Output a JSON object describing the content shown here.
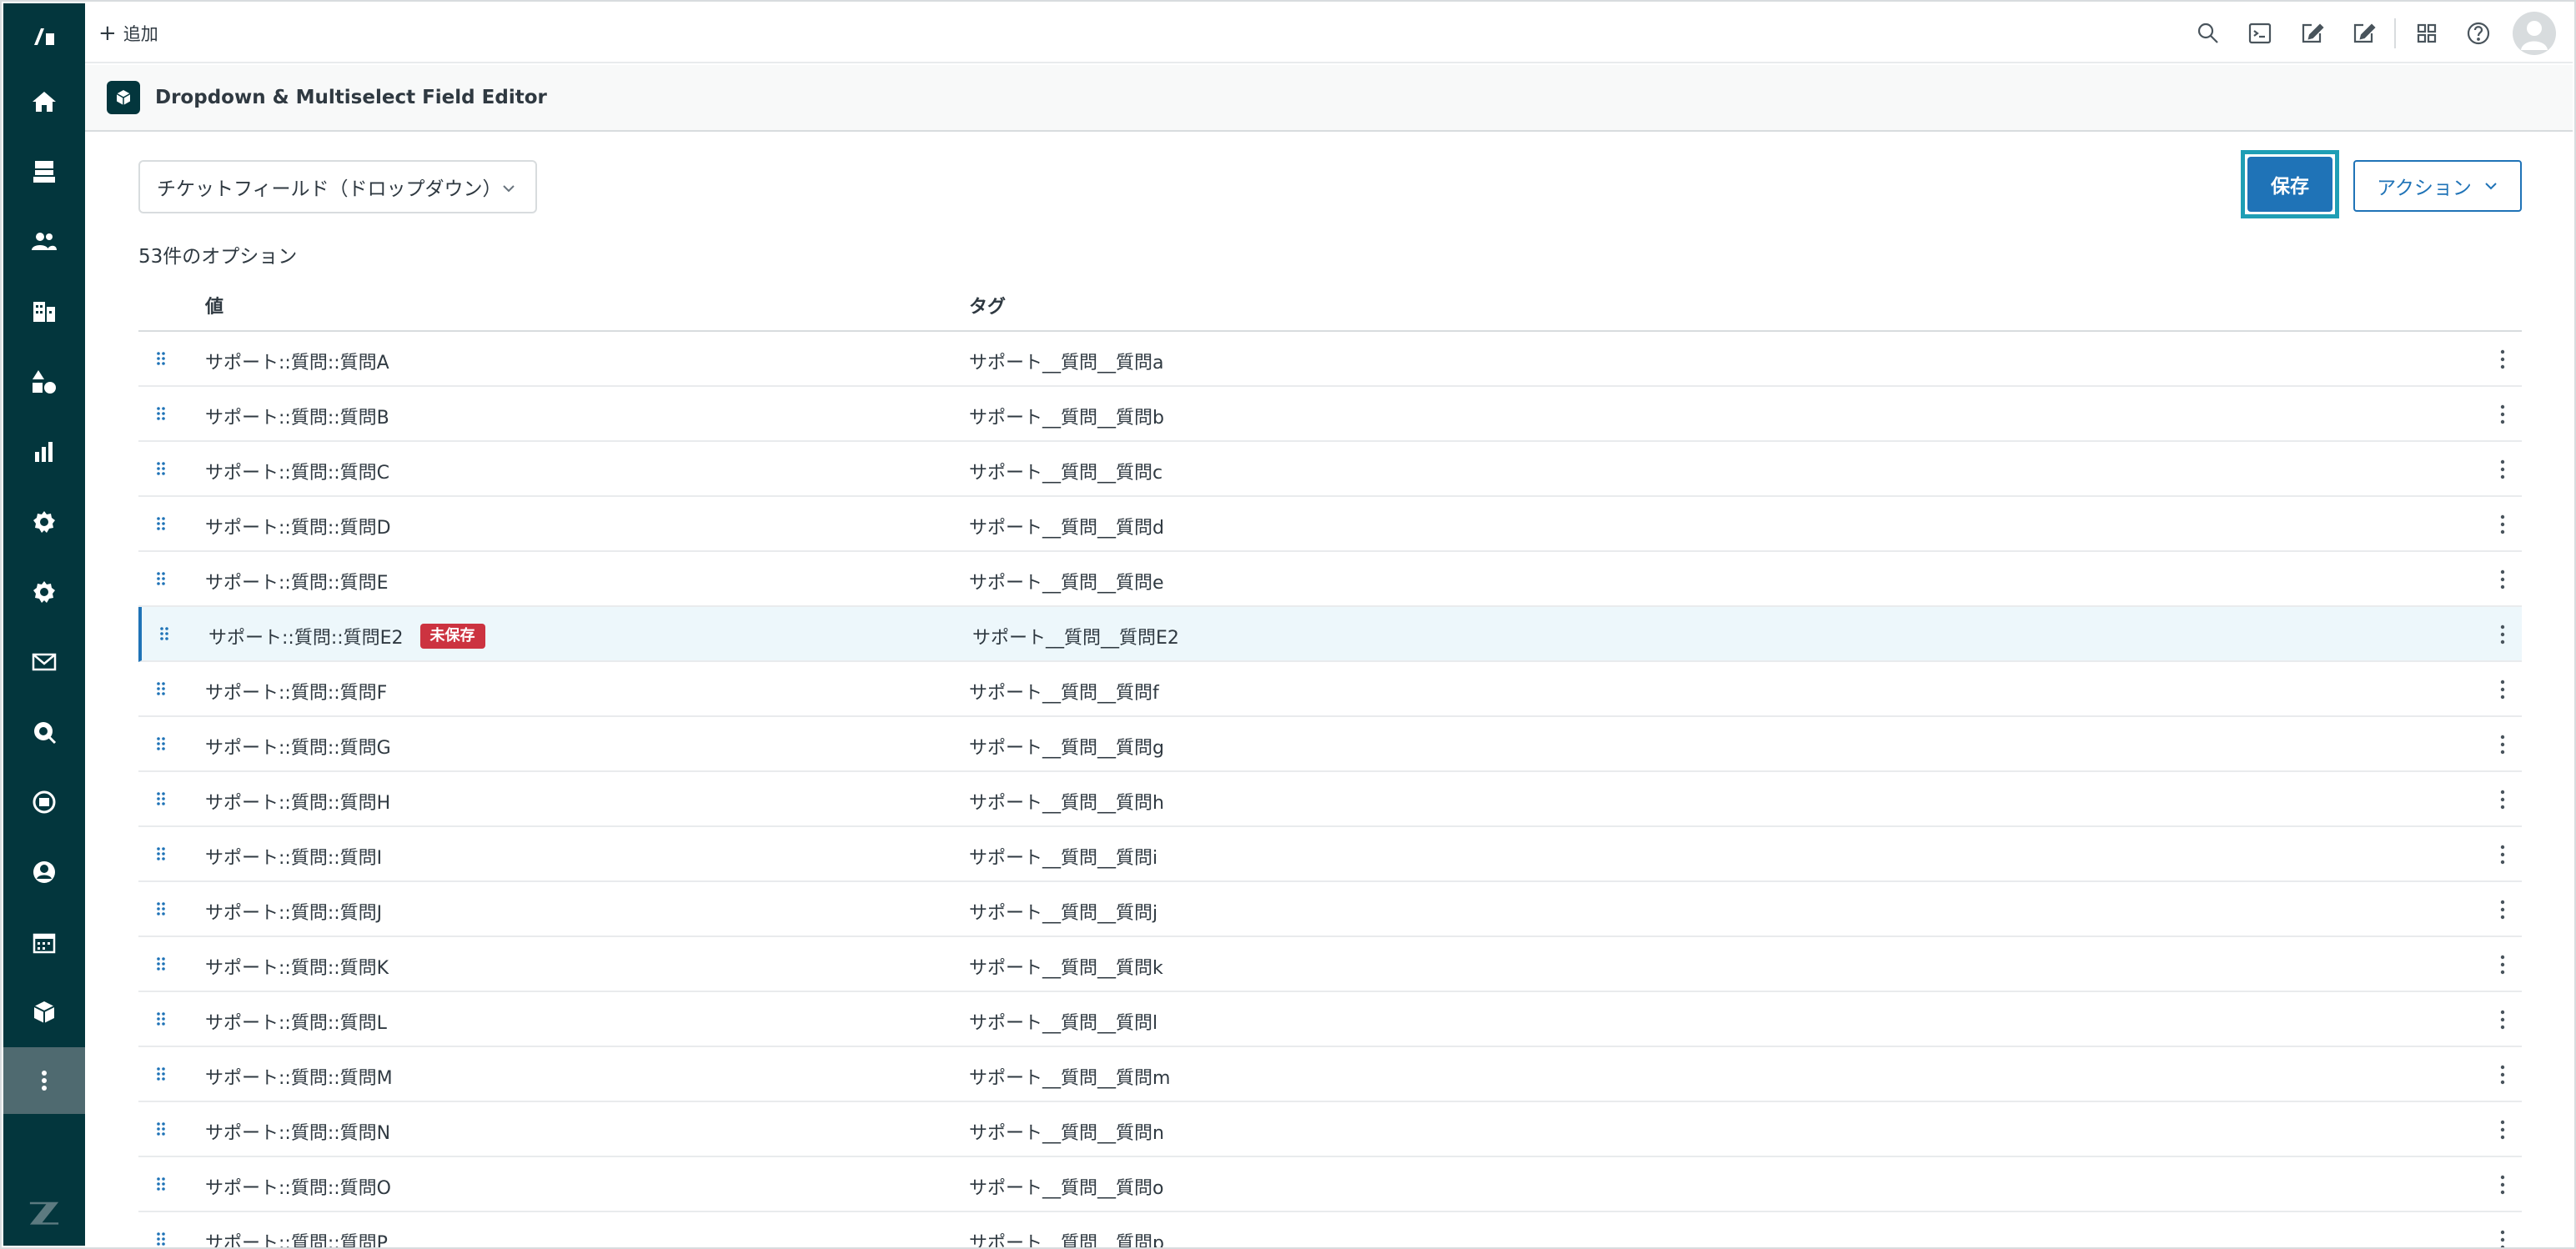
{
  "topbar": {
    "add_label": "追加"
  },
  "app": {
    "title": "Dropdown & Multiselect Field Editor"
  },
  "field_select": {
    "value": "チケットフィールド（ドロップダウン）"
  },
  "buttons": {
    "save": "保存",
    "action": "アクション"
  },
  "options_count": "53件のオプション",
  "table": {
    "headers": {
      "value": "値",
      "tag": "タグ"
    },
    "rows": [
      {
        "value": "サポート::質問::質問A",
        "tag": "サポート__質問__質問a"
      },
      {
        "value": "サポート::質問::質問B",
        "tag": "サポート__質問__質問b"
      },
      {
        "value": "サポート::質問::質問C",
        "tag": "サポート__質問__質問c"
      },
      {
        "value": "サポート::質問::質問D",
        "tag": "サポート__質問__質問d"
      },
      {
        "value": "サポート::質問::質問E",
        "tag": "サポート__質問__質問e"
      },
      {
        "value": "サポート::質問::質問E2",
        "tag": "サポート__質問__質問E2",
        "badge": "未保存"
      },
      {
        "value": "サポート::質問::質問F",
        "tag": "サポート__質問__質問f"
      },
      {
        "value": "サポート::質問::質問G",
        "tag": "サポート__質問__質問g"
      },
      {
        "value": "サポート::質問::質問H",
        "tag": "サポート__質問__質問h"
      },
      {
        "value": "サポート::質問::質問I",
        "tag": "サポート__質問__質問i"
      },
      {
        "value": "サポート::質問::質問J",
        "tag": "サポート__質問__質問j"
      },
      {
        "value": "サポート::質問::質問K",
        "tag": "サポート__質問__質問k"
      },
      {
        "value": "サポート::質問::質問L",
        "tag": "サポート__質問__質問l"
      },
      {
        "value": "サポート::質問::質問M",
        "tag": "サポート__質問__質問m"
      },
      {
        "value": "サポート::質問::質問N",
        "tag": "サポート__質問__質問n"
      },
      {
        "value": "サポート::質問::質問O",
        "tag": "サポート__質問__質問o"
      },
      {
        "value": "サポート::質問::質問P",
        "tag": "サポート__質問__質問p"
      }
    ]
  },
  "icons": {
    "sidebar": [
      "zendesk-logo-icon",
      "home-icon",
      "views-icon",
      "customers-icon",
      "organizations-icon",
      "objects-icon",
      "reporting-icon",
      "admin-icon",
      "settings-icon",
      "mail-icon",
      "explore-icon",
      "guide-icon",
      "agent-icon",
      "calendar-icon",
      "apps-icon",
      "more-icon",
      "zendesk-z-icon"
    ],
    "topbar": [
      "search-icon",
      "console-icon",
      "compose-icon",
      "edit-icon",
      "grid-icon",
      "help-icon",
      "avatar-icon"
    ]
  },
  "colors": {
    "sidebar": "#03363d",
    "primary": "#1f73b7",
    "focus_ring": "#1f9eb5",
    "badge": "#cc3340",
    "highlight_row": "#edf7fb"
  }
}
